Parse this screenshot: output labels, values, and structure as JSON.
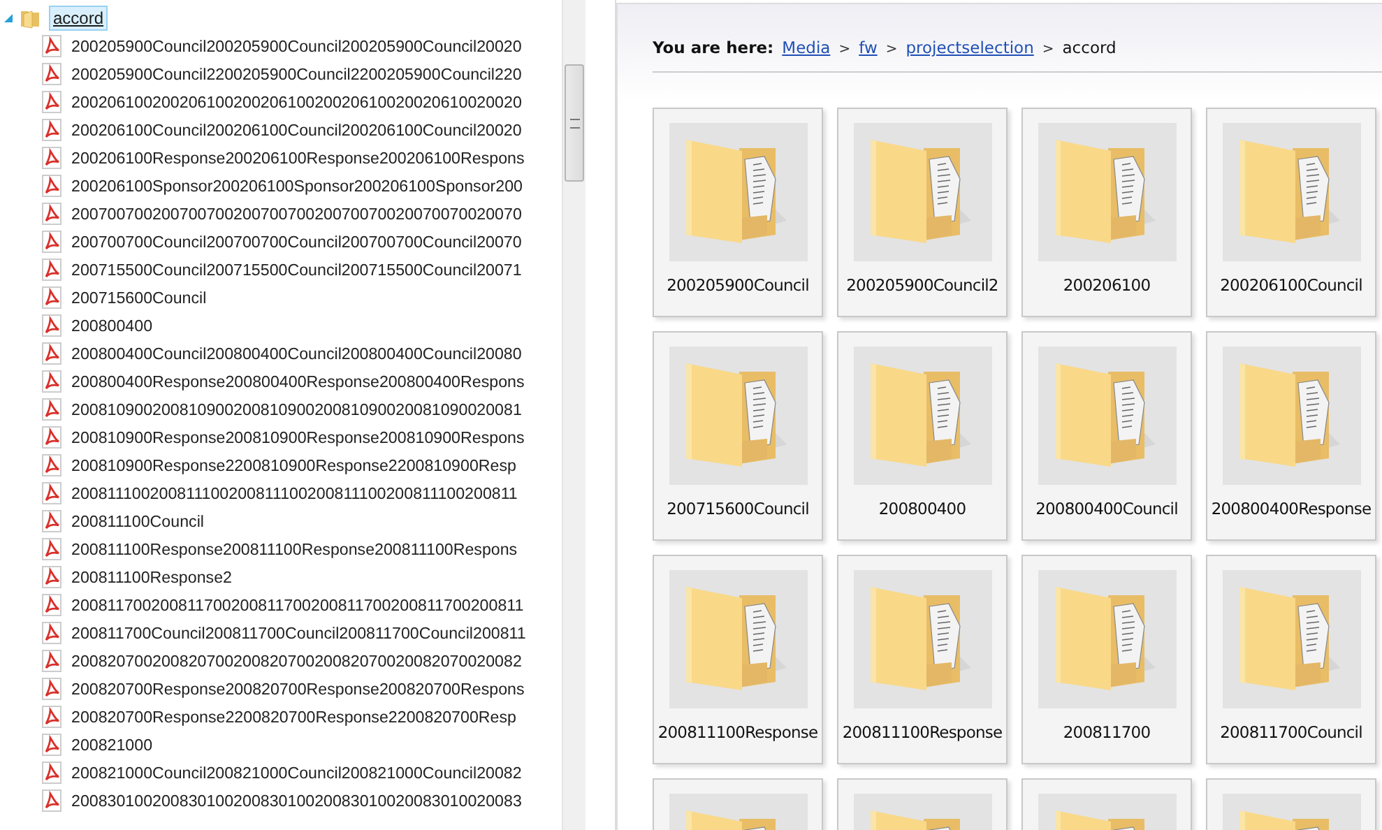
{
  "tree": {
    "folder": {
      "label": "accord",
      "selected": true,
      "expanded": true
    },
    "files": [
      "200205900Council200205900Council200205900Council20020",
      "200205900Council2200205900Council2200205900Council220",
      "20020610020020610020020610020020610020020610020020",
      "200206100Council200206100Council200206100Council20020",
      "200206100Response200206100Response200206100Respons",
      "200206100Sponsor200206100Sponsor200206100Sponsor200",
      "20070070020070070020070070020070070020070070020070",
      "200700700Council200700700Council200700700Council20070",
      "200715500Council200715500Council200715500Council20071",
      "200715600Council",
      "200800400",
      "200800400Council200800400Council200800400Council20080",
      "200800400Response200800400Response200800400Respons",
      "20081090020081090020081090020081090020081090020081",
      "200810900Response200810900Response200810900Respons",
      "200810900Response2200810900Response2200810900Resp",
      "200811100200811100200811100200811100200811100200811",
      "200811100Council",
      "200811100Response200811100Response200811100Respons",
      "200811100Response2",
      "200811700200811700200811700200811700200811700200811",
      "200811700Council200811700Council200811700Council200811",
      "20082070020082070020082070020082070020082070020082",
      "200820700Response200820700Response200820700Respons",
      "200820700Response2200820700Response2200820700Resp",
      "200821000",
      "200821000Council200821000Council200821000Council20082",
      "20083010020083010020083010020083010020083010020083"
    ]
  },
  "breadcrumb": {
    "label": "You are here:",
    "links": [
      "Media",
      "fw",
      "projectselection"
    ],
    "current": "accord",
    "separator": ">"
  },
  "folders": [
    {
      "kind": "folder",
      "label": "200205900Council"
    },
    {
      "kind": "folder",
      "label": "200205900Council2"
    },
    {
      "kind": "folder",
      "label": "200206100"
    },
    {
      "kind": "folder",
      "label": "200206100Council"
    },
    {
      "kind": "folder",
      "label": "200715600Council"
    },
    {
      "kind": "folder",
      "label": "200800400"
    },
    {
      "kind": "folder",
      "label": "200800400Council"
    },
    {
      "kind": "folder",
      "label": "200800400Response"
    },
    {
      "kind": "folder",
      "label": "200811100Response"
    },
    {
      "kind": "folder",
      "label": "200811100Response"
    },
    {
      "kind": "folder",
      "label": "200811700"
    },
    {
      "kind": "folder",
      "label": "200811700Council"
    },
    {
      "kind": "folder"
    },
    {
      "kind": "folder"
    },
    {
      "kind": "folder"
    },
    {
      "kind": "folder"
    }
  ]
}
